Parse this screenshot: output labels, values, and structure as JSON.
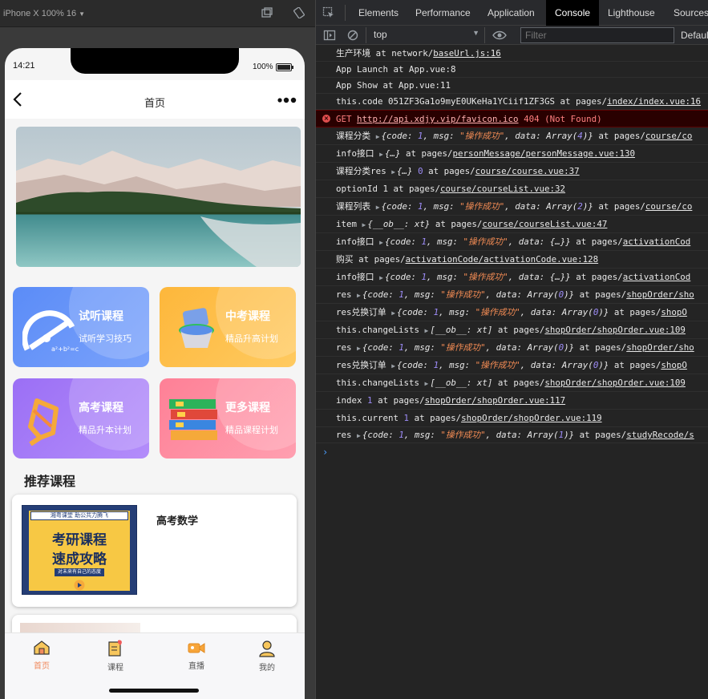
{
  "device_toolbar": {
    "device_label": "iPhone X  100%  16"
  },
  "phone": {
    "status_time": "14:21",
    "battery_percent": "100%",
    "battery_level": 1.0,
    "page_title": "首页",
    "categories": [
      {
        "title": "试听课程",
        "subtitle": "试听学习技巧"
      },
      {
        "title": "中考课程",
        "subtitle": "精品升高计划"
      },
      {
        "title": "高考课程",
        "subtitle": "精品升本计划"
      },
      {
        "title": "更多课程",
        "subtitle": "精品课程计划"
      }
    ],
    "recommend_title": "推荐课程",
    "courses": [
      {
        "name": "高考数学",
        "thumb_top": "湘粤课堂 助公共力腾飞",
        "thumb_line1": "考研课程",
        "thumb_line2": "速成攻略",
        "thumb_tag": "对未来有自己的态度"
      }
    ],
    "tabs": [
      "首页",
      "课程",
      "直播",
      "我的"
    ]
  },
  "devtools": {
    "tabs": [
      "Elements",
      "Performance",
      "Application",
      "Console",
      "Lighthouse",
      "Sources"
    ],
    "active_tab": "Console",
    "context": "top",
    "filter_placeholder": "Filter",
    "levels_label": "Default levels",
    "logs": [
      {
        "text": "生产环境  at network/",
        "file": "baseUrl.js:16"
      },
      {
        "text": "App Launch  at App.vue:8"
      },
      {
        "text": "App Show  at App.vue:11"
      },
      {
        "text": "this.code 051ZF3Ga1o9myE0UKeHa1YCiif1ZF3GS  at pages/",
        "file": "index/index.vue:16"
      },
      {
        "error": true,
        "method": "GET",
        "url": "http://api.xdjy.vip/favicon.ico",
        "status": "404 (Not Found)"
      },
      {
        "label": "课程分类",
        "obj": "{code: 1, msg: \"操作成功\", data: Array(4)}",
        "at": "at pages/",
        "file": "course/co"
      },
      {
        "label": "info接口",
        "obj": "{…}",
        "at": "at pages/",
        "file": "personMessage/personMessage.vue:130"
      },
      {
        "label": "课程分类res",
        "obj": "{…}",
        "num": "0",
        "at": "at pages/",
        "file": "course/course.vue:37"
      },
      {
        "text": "optionId 1  at pages/",
        "file": "course/courseList.vue:32"
      },
      {
        "label": "课程列表",
        "obj": "{code: 1, msg: \"操作成功\", data: Array(2)}",
        "at": "at pages/",
        "file": "course/co"
      },
      {
        "label": "item",
        "obj": "{__ob__: xt}",
        "at": "at pages/",
        "file": "course/courseList.vue:47"
      },
      {
        "label": "info接口",
        "obj": "{code: 1, msg: \"操作成功\", data: {…}}",
        "at": "at pages/",
        "file": "activationCod"
      },
      {
        "text": "购买  at pages/",
        "file": "activationCode/activationCode.vue:128"
      },
      {
        "label": "info接口",
        "obj": "{code: 1, msg: \"操作成功\", data: {…}}",
        "at": "at pages/",
        "file": "activationCod"
      },
      {
        "label": "res",
        "obj": "{code: 1, msg: \"操作成功\", data: Array(0)}",
        "at": "at pages/",
        "file": "shopOrder/sho"
      },
      {
        "label": "res兑换订单",
        "obj": "{code: 1, msg: \"操作成功\", data: Array(0)}",
        "at": "at pages/",
        "file": "shopO"
      },
      {
        "label": "this.changeLists",
        "obj": "[__ob__: xt]",
        "at": "at pages/",
        "file": "shopOrder/shopOrder.vue:109"
      },
      {
        "label": "res",
        "obj": "{code: 1, msg: \"操作成功\", data: Array(0)}",
        "at": "at pages/",
        "file": "shopOrder/sho"
      },
      {
        "label": "res兑换订单",
        "obj": "{code: 1, msg: \"操作成功\", data: Array(0)}",
        "at": "at pages/",
        "file": "shopO"
      },
      {
        "label": "this.changeLists",
        "obj": "[__ob__: xt]",
        "at": "at pages/",
        "file": "shopOrder/shopOrder.vue:109"
      },
      {
        "label": "index",
        "num": "1",
        "at": "at pages/",
        "file": "shopOrder/shopOrder.vue:117"
      },
      {
        "label": "this.current",
        "num": "1",
        "at": "at pages/",
        "file": "shopOrder/shopOrder.vue:119"
      },
      {
        "label": "res",
        "obj": "{code: 1, msg: \"操作成功\", data: Array(1)}",
        "at": "at pages/",
        "file": "studyRecode/s"
      }
    ]
  }
}
